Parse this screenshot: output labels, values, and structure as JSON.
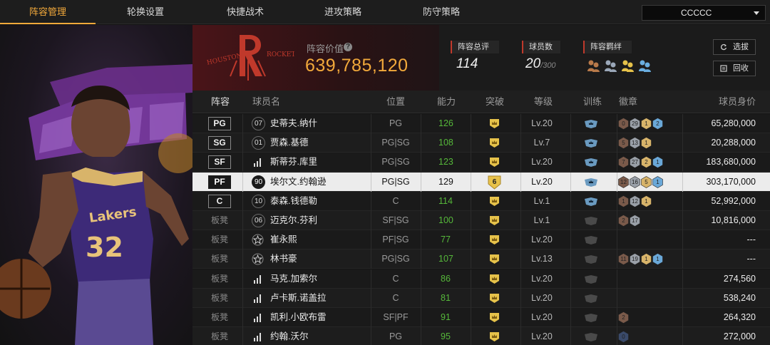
{
  "nav": {
    "tabs": [
      {
        "label": "阵容管理",
        "active": true
      },
      {
        "label": "轮换设置",
        "active": false
      },
      {
        "label": "快捷战术",
        "active": false
      },
      {
        "label": "进攻策略",
        "active": false
      },
      {
        "label": "防守策略",
        "active": false
      }
    ],
    "team_select": "CCCCC"
  },
  "header": {
    "value_label": "阵容价值",
    "value": "639,785,120",
    "stats": [
      {
        "label": "阵容总评",
        "value": "114",
        "suffix": ""
      },
      {
        "label": "球员数",
        "value": "20",
        "suffix": "/300"
      },
      {
        "label": "阵容羁绊",
        "value": "",
        "suffix": ""
      }
    ],
    "buttons": {
      "select": "选拔",
      "recycle": "回收"
    }
  },
  "table": {
    "headers": {
      "lineup": "阵容",
      "name": "球员名",
      "position": "位置",
      "ability": "能力",
      "breakthrough": "突破",
      "level": "等级",
      "training": "训练",
      "badges": "徽章",
      "value": "球员身价"
    },
    "rows": [
      {
        "slot": "PG",
        "num": "07",
        "name": "史蒂夫.纳什",
        "pos": "PG",
        "ability": "126",
        "level": "Lv.20",
        "badges": [
          "0",
          "29",
          "1",
          "2"
        ],
        "value": "65,280,000"
      },
      {
        "slot": "SG",
        "num": "01",
        "name": "贾森.基德",
        "pos": "PG|SG",
        "ability": "108",
        "level": "Lv.7",
        "badges": [
          "5",
          "13",
          "1"
        ],
        "value": "20,288,000"
      },
      {
        "slot": "SF",
        "num": "",
        "name": "斯蒂芬.库里",
        "pos": "PG|SG",
        "ability": "123",
        "level": "Lv.20",
        "badges": [
          "7",
          "27",
          "2",
          "1"
        ],
        "value": "183,680,000"
      },
      {
        "slot": "PF",
        "num": "90",
        "name": "埃尔文.约翰逊",
        "pos": "PG|SG",
        "ability": "129",
        "level": "Lv.20",
        "breakthrough": "6",
        "badges": [
          "12",
          "16",
          "5",
          "1"
        ],
        "value": "303,170,000"
      },
      {
        "slot": "C",
        "num": "10",
        "name": "泰森.钱德勒",
        "pos": "C",
        "ability": "114",
        "level": "Lv.1",
        "badges": [
          "1",
          "12",
          "1"
        ],
        "value": "52,992,000"
      },
      {
        "slot": "板凳",
        "num": "06",
        "name": "迈克尔.芬利",
        "pos": "SF|SG",
        "ability": "100",
        "level": "Lv.1",
        "badges": [
          "2",
          "17"
        ],
        "value": "10,816,000"
      },
      {
        "slot": "板凳",
        "num": "",
        "name": "崔永熙",
        "pos": "PF|SG",
        "ability": "77",
        "level": "Lv.20",
        "badges": [],
        "value": "---"
      },
      {
        "slot": "板凳",
        "num": "",
        "name": "林书豪",
        "pos": "PG|SG",
        "ability": "107",
        "level": "Lv.13",
        "badges": [
          "11",
          "19",
          "1",
          "1"
        ],
        "value": "---"
      },
      {
        "slot": "板凳",
        "num": "",
        "name": "马克.加索尔",
        "pos": "C",
        "ability": "86",
        "level": "Lv.20",
        "badges": [],
        "value": "274,560"
      },
      {
        "slot": "板凳",
        "num": "",
        "name": "卢卡斯.诺盖拉",
        "pos": "C",
        "ability": "81",
        "level": "Lv.20",
        "badges": [],
        "value": "538,240"
      },
      {
        "slot": "板凳",
        "num": "",
        "name": "凯利.小欧布雷",
        "pos": "SF|PF",
        "ability": "91",
        "level": "Lv.20",
        "badges": [
          "2"
        ],
        "value": "264,320"
      },
      {
        "slot": "板凳",
        "num": "",
        "name": "约翰.沃尔",
        "pos": "PG",
        "ability": "95",
        "level": "Lv.20",
        "badges": [
          "0"
        ],
        "value": "272,000"
      }
    ]
  },
  "colors": {
    "accent": "#f2a93b",
    "ability_green": "#56b83a",
    "team_red": "#c0392b"
  }
}
